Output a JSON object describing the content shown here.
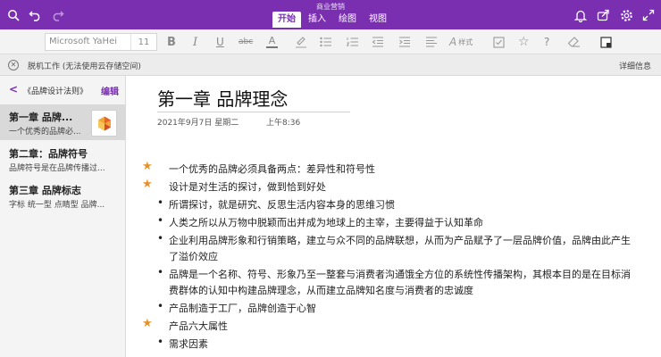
{
  "window": {
    "title": "商业营销",
    "tabs": [
      {
        "label": "开始",
        "active": true
      },
      {
        "label": "插入",
        "active": false
      },
      {
        "label": "绘图",
        "active": false
      },
      {
        "label": "视图",
        "active": false
      }
    ]
  },
  "ribbon": {
    "font_name": "Microsoft YaHei",
    "font_size": "11",
    "styles_label": "样式"
  },
  "offline_bar": {
    "message": "脱机工作 (无法使用云存储空间)",
    "details_label": "详细信息"
  },
  "sidebar": {
    "notebook_title": "《品牌设计法则》",
    "edit_label": "编辑",
    "pages": [
      {
        "title": "第一章 品牌...",
        "preview": "一个优秀的品牌必...",
        "selected": true
      },
      {
        "title": "第二章：品牌符号",
        "preview": "品牌符号是在品牌传播过...",
        "selected": false
      },
      {
        "title": "第三章 品牌标志",
        "preview": "字标  统一型  点睛型  品牌...",
        "selected": false
      }
    ]
  },
  "page": {
    "title": "第一章 品牌理念",
    "date": "2021年9月7日 星期二",
    "time": "上午8:36",
    "lines": [
      {
        "kind": "star",
        "text": "一个优秀的品牌必须具备两点：差异性和符号性"
      },
      {
        "kind": "star",
        "text": "设计是对生活的探讨，做到恰到好处"
      },
      {
        "kind": "bullet",
        "text": "所谓探讨，就是研究、反思生活内容本身的思维习惯"
      },
      {
        "kind": "bullet",
        "text": "人类之所以从万物中脱颖而出并成为地球上的主宰，主要得益于认知革命"
      },
      {
        "kind": "bullet",
        "text": "企业利用品牌形象和行销策略，建立与众不同的品牌联想，从而为产品赋予了一层品牌价值，品牌由此产生"
      },
      {
        "kind": "continuation",
        "text": "了溢价效应"
      },
      {
        "kind": "bullet",
        "text": "品牌是一个名称、符号、形象乃至一整套与消费者沟通饿全方位的系统性传播架构，其根本目的是在目标消"
      },
      {
        "kind": "continuation",
        "text": "费群体的认知中构建品牌理念，从而建立品牌知名度与消费者的忠诚度"
      },
      {
        "kind": "bullet",
        "text": "产品制造于工厂，品牌创造于心智"
      },
      {
        "kind": "star",
        "text": "产品六大属性"
      },
      {
        "kind": "bullet",
        "text": "需求因素"
      }
    ]
  },
  "colors": {
    "accent": "#7a2fb1",
    "star": "#e8902a",
    "sidebar_bg": "#f4f4f4",
    "selected_bg": "#d9d9d9"
  },
  "icons": {
    "titlebar_left": [
      "search-icon",
      "undo-icon",
      "redo-icon"
    ],
    "titlebar_right": [
      "bell-icon",
      "share-icon",
      "gear-icon",
      "expand-icon"
    ],
    "ribbon": [
      "bold-icon",
      "italic-icon",
      "underline-icon",
      "strikethrough-icon",
      "font-color-icon",
      "highlight-icon",
      "bullet-list-icon",
      "numbered-list-icon",
      "outdent-icon",
      "indent-icon",
      "align-icon",
      "styles-icon",
      "checkbox-icon",
      "star-icon",
      "question-icon",
      "eraser-icon",
      "tag-icon"
    ]
  }
}
